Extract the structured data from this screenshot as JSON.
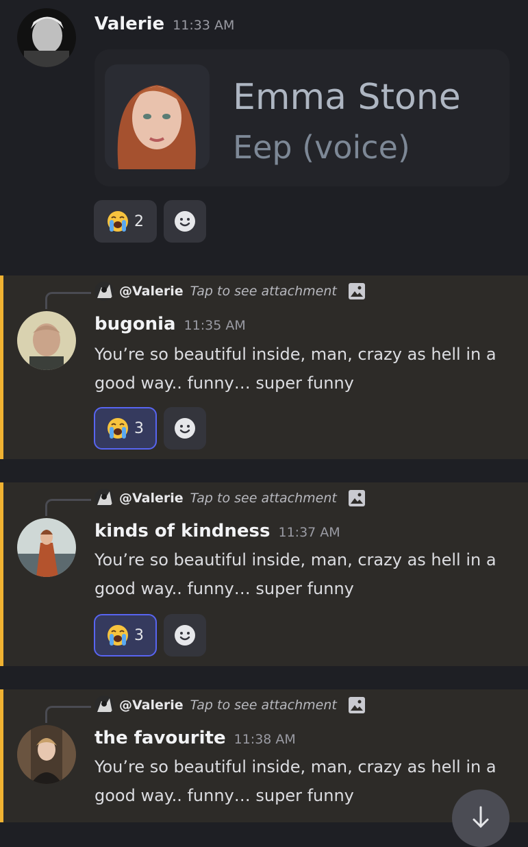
{
  "messages": [
    {
      "author": "Valerie",
      "time": "11:33 AM",
      "card": {
        "title": "Emma Stone",
        "subtitle": "Eep (voice)"
      },
      "reactions": [
        {
          "emoji": "loudly-crying-face",
          "count": "2"
        }
      ]
    },
    {
      "reply": {
        "user": "@Valerie",
        "text": "Tap to see attachment"
      },
      "author": "bugonia",
      "time": "11:35 AM",
      "body": "You’re so beautiful inside, man, crazy as hell in a good way.. funny… super funny",
      "reactions": [
        {
          "emoji": "loudly-crying-face",
          "count": "3"
        }
      ]
    },
    {
      "reply": {
        "user": "@Valerie",
        "text": "Tap to see attachment"
      },
      "author": "kinds of kindness",
      "time": "11:37 AM",
      "body": "You’re so beautiful inside, man, crazy as hell in a good way.. funny… super funny",
      "reactions": [
        {
          "emoji": "loudly-crying-face",
          "count": "3"
        }
      ]
    },
    {
      "reply": {
        "user": "@Valerie",
        "text": "Tap to see attachment"
      },
      "author": "the favourite",
      "time": "11:38 AM",
      "body": "You’re so beautiful inside, man, crazy as hell in a good way.. funny… super funny"
    }
  ],
  "colors": {
    "background": "#1e1f24",
    "highlight": "#2d2b28",
    "mention_bar": "#f0b232",
    "reaction_active_border": "#5865f2"
  },
  "icons": {
    "add_reaction": "smiley-face-icon",
    "attachment": "image-icon",
    "scroll_down": "arrow-down-icon"
  }
}
